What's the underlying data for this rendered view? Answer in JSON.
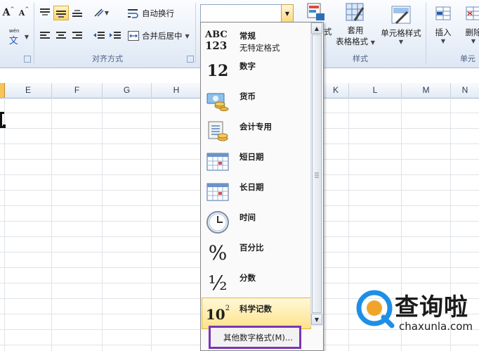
{
  "ribbon": {
    "font_grow_label": "A",
    "font_shrink_label": "A",
    "phonetic_top": "wén",
    "phonetic_bottom": "文",
    "wrap_text_label": "自动换行",
    "merge_center_label": "合并后居中",
    "alignment_group_label": "对齐方式",
    "styles_partial_label": "式",
    "table_format_line1": "套用",
    "table_format_line2": "表格格式",
    "cell_styles_label": "单元格样式",
    "styles_group_label": "样式",
    "insert_label": "插入",
    "delete_label": "删除",
    "cells_group_partial": "单元",
    "number_format_value": ""
  },
  "sheet": {
    "columns_left": [
      "E",
      "F",
      "G",
      "H"
    ],
    "columns_right": [
      "K",
      "L",
      "M",
      "N"
    ]
  },
  "dropdown": {
    "items": [
      {
        "title": "常规",
        "subtitle": "无特定格式",
        "icon": "general-abc123-icon",
        "icon_text_1": "ABC",
        "icon_text_2": "123"
      },
      {
        "title": "数字",
        "subtitle": "",
        "icon": "number-12-icon",
        "icon_text_1": "12"
      },
      {
        "title": "货币",
        "subtitle": "",
        "icon": "currency-icon"
      },
      {
        "title": "会计专用",
        "subtitle": "",
        "icon": "accounting-icon"
      },
      {
        "title": "短日期",
        "subtitle": "",
        "icon": "short-date-calendar-icon"
      },
      {
        "title": "长日期",
        "subtitle": "",
        "icon": "long-date-calendar-icon"
      },
      {
        "title": "时间",
        "subtitle": "",
        "icon": "clock-icon"
      },
      {
        "title": "百分比",
        "subtitle": "",
        "icon": "percent-icon",
        "icon_text_1": "%"
      },
      {
        "title": "分数",
        "subtitle": "",
        "icon": "fraction-icon",
        "icon_text_1": "½"
      },
      {
        "title": "科学记数",
        "subtitle": "",
        "icon": "scientific-icon",
        "icon_text_1": "10",
        "icon_text_2": "2"
      }
    ],
    "more_formats_label": "其他数字格式(M)...",
    "highlighted_item": "科学记数"
  },
  "watermark": {
    "brand": "查询啦",
    "domain": "chaxunla.com"
  },
  "colors": {
    "accent_purple": "#7a36b5",
    "hover_gold": "#ffe38a",
    "ribbon_blue": "#dde7f4",
    "watermark_blue": "#1f8fe6"
  }
}
